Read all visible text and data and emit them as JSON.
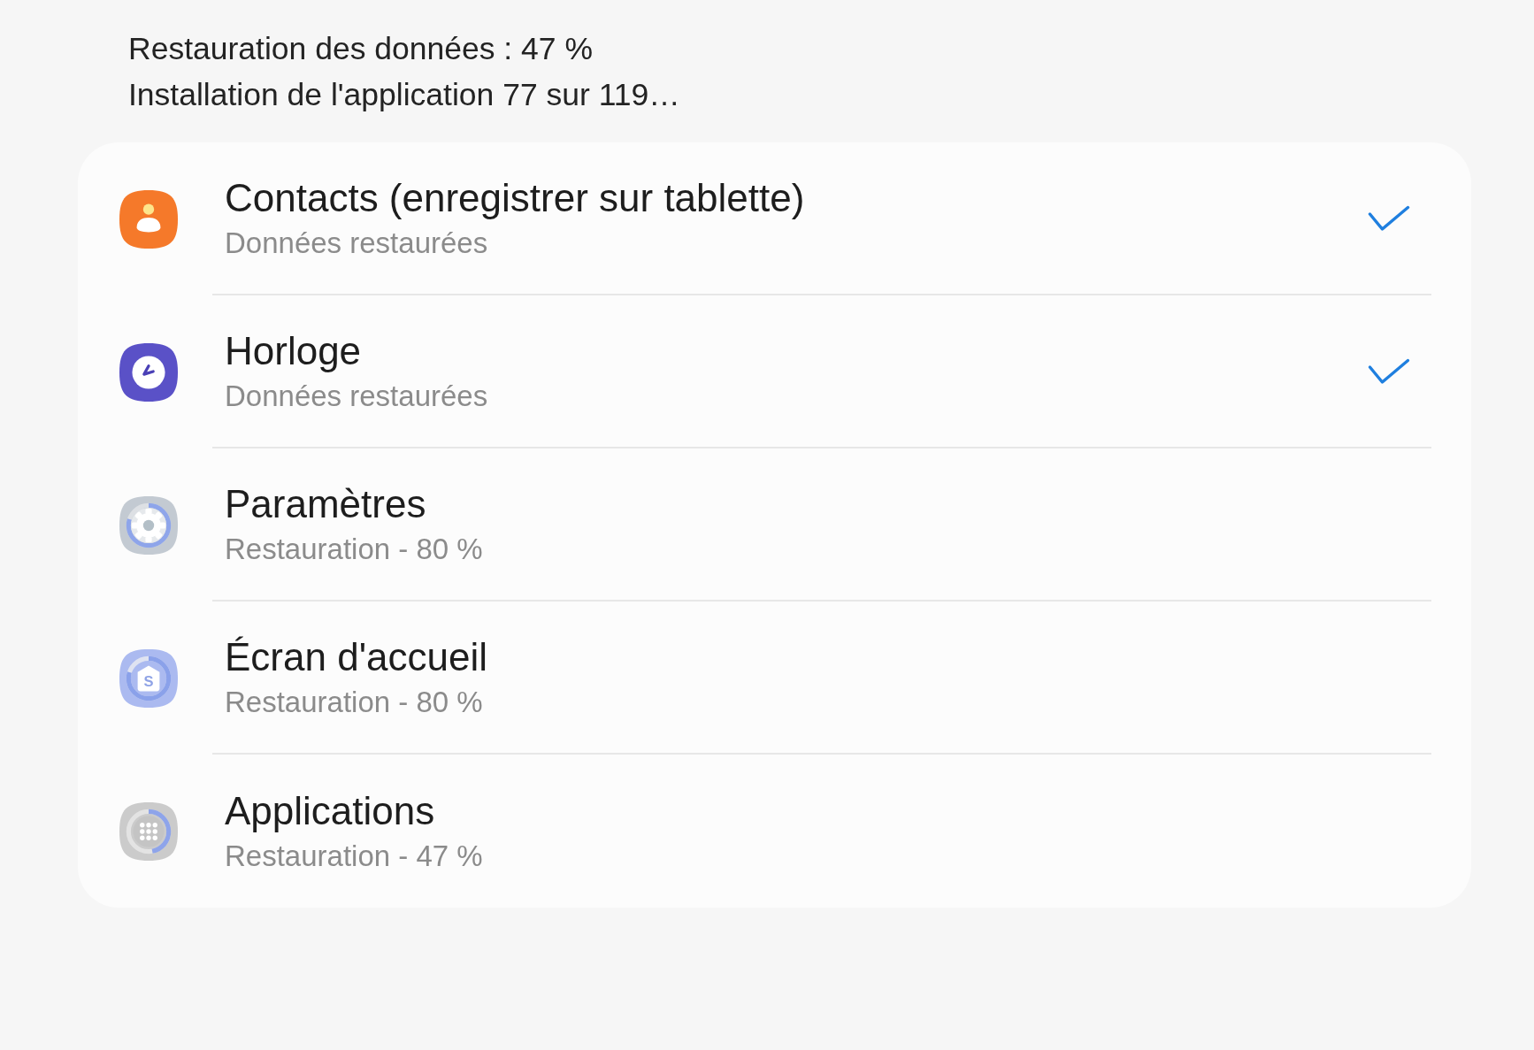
{
  "status_lines": [
    "Restauration des données : 47 %",
    "Installation de l'application 77 sur 119…"
  ],
  "items": [
    {
      "kind": "contacts",
      "title": "Contacts (enregistrer sur tablette)",
      "subtitle": "Données restaurées",
      "done": true
    },
    {
      "kind": "clock",
      "title": "Horloge",
      "subtitle": "Données restaurées",
      "done": true
    },
    {
      "kind": "settings",
      "title": "Paramètres",
      "subtitle": "Restauration - 80 %",
      "done": false,
      "level": 0.8
    },
    {
      "kind": "home",
      "title": "Écran d'accueil",
      "subtitle": "Restauration - 80 %",
      "done": false,
      "level": 0.8,
      "icon_text": "S"
    },
    {
      "kind": "apps",
      "title": "Applications",
      "subtitle": "Restauration - 47 %",
      "done": false,
      "level": 0.47
    }
  ]
}
